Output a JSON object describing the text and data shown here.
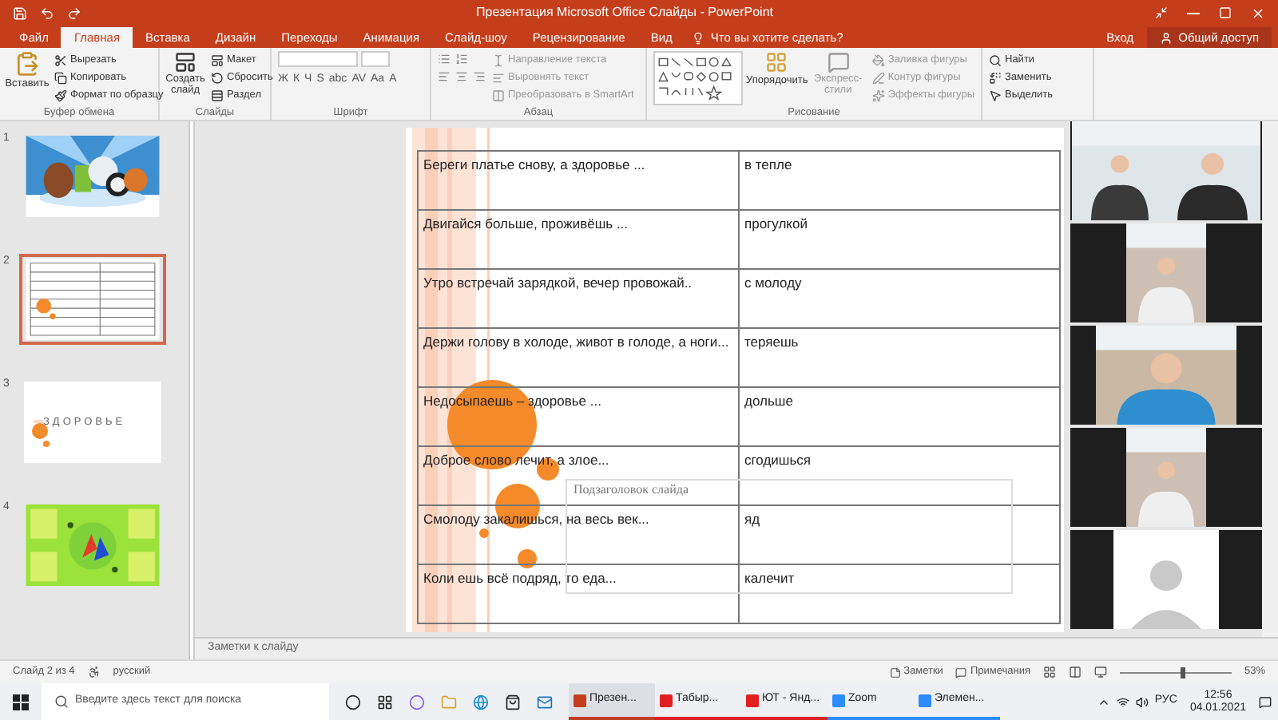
{
  "window": {
    "title": "Презентация Microsoft Office Слайды - PowerPoint"
  },
  "tabs": [
    {
      "label": "Файл",
      "selected": false
    },
    {
      "label": "Главная",
      "selected": true
    },
    {
      "label": "Вставка",
      "selected": false
    },
    {
      "label": "Дизайн",
      "selected": false
    },
    {
      "label": "Переходы",
      "selected": false
    },
    {
      "label": "Анимация",
      "selected": false
    },
    {
      "label": "Слайд-шоу",
      "selected": false
    },
    {
      "label": "Рецензирование",
      "selected": false
    },
    {
      "label": "Вид",
      "selected": false
    }
  ],
  "tell_me": "Что вы хотите сделать?",
  "account": {
    "sign_in": "Вход",
    "share": "Общий доступ"
  },
  "ribbon": {
    "clipboard": {
      "label": "Буфер обмена",
      "paste": "Вставить",
      "items": [
        "Вырезать",
        "Копировать",
        "Формат по образцу"
      ]
    },
    "slides": {
      "label": "Слайды",
      "new_slide": "Создать слайд",
      "items": [
        "Макет",
        "Сбросить",
        "Раздел"
      ]
    },
    "font": {
      "label": "Шрифт",
      "buttons": [
        "Ж",
        "К",
        "Ч",
        "S",
        "abc",
        "AV",
        "Aa",
        "A"
      ]
    },
    "paragraph": {
      "label": "Абзац",
      "items": [
        "Направление текста",
        "Выровнять текст",
        "Преобразовать в SmartArt"
      ]
    },
    "drawing": {
      "label": "Рисование",
      "arrange": "Упорядочить",
      "styles": "Экспресс-стили",
      "items": [
        "Заливка фигуры",
        "Контур фигуры",
        "Эффекты фигуры"
      ]
    },
    "editing": {
      "items": [
        "Найти",
        "Заменить",
        "Выделить"
      ]
    }
  },
  "thumbnails": [
    {
      "number": "1",
      "kind": "picture",
      "selected": false
    },
    {
      "number": "2",
      "kind": "table",
      "selected": true
    },
    {
      "number": "3",
      "kind": "title",
      "title": "ЗДОРОВЬЕ",
      "selected": false
    },
    {
      "number": "4",
      "kind": "poster",
      "selected": false
    }
  ],
  "slide": {
    "rows": [
      {
        "left": "Береги платье снову, а здоровье ...",
        "right": "в тепле"
      },
      {
        "left": "Двигайся больше, проживёшь ...",
        "right": "прогулкой"
      },
      {
        "left": "Утро встречай зарядкой, вечер провожай..",
        "right": "с молоду"
      },
      {
        "left": "Держи голову в холоде, живот в голоде, а ноги...",
        "right": "теряешь"
      },
      {
        "left": "Недосыпаешь – здоровье ...",
        "right": "дольше"
      },
      {
        "left": "Доброе слово лечит, а злое...",
        "right": "сгодишься"
      },
      {
        "left": "Смолоду закалишься, на весь век...",
        "right": "яд"
      },
      {
        "left": "Коли ешь всё подряд, то еда...",
        "right": "калечит"
      }
    ],
    "placeholder": "Подзаголовок слайда"
  },
  "video_tiles": [
    {
      "kind": "pair"
    },
    {
      "kind": "child"
    },
    {
      "kind": "child_wide"
    },
    {
      "kind": "child"
    },
    {
      "kind": "avatar"
    }
  ],
  "notes": "Заметки к слайду",
  "status_bar": {
    "slide": "Слайд 2 из 4",
    "language": "русский",
    "notes": "Заметки",
    "comments": "Примечания",
    "zoom_slider": {
      "level": 0.55
    },
    "zoom": "53%"
  },
  "taskbar": {
    "search_placeholder": "Введите здесь текст для поиска",
    "apps": [
      {
        "label": "Презен...",
        "color": "#c43e1c",
        "active": true
      },
      {
        "label": "Табыр...",
        "color": "#e02020",
        "active": false
      },
      {
        "label": "ЮТ - Янд...",
        "color": "#e02020",
        "active": false
      },
      {
        "label": "Zoom",
        "color": "#2d8cff",
        "active": false
      },
      {
        "label": "Элемен...",
        "color": "#2d8cff",
        "active": false
      }
    ],
    "language": "РУС",
    "time": "12:56",
    "date": "04.01.2021"
  }
}
